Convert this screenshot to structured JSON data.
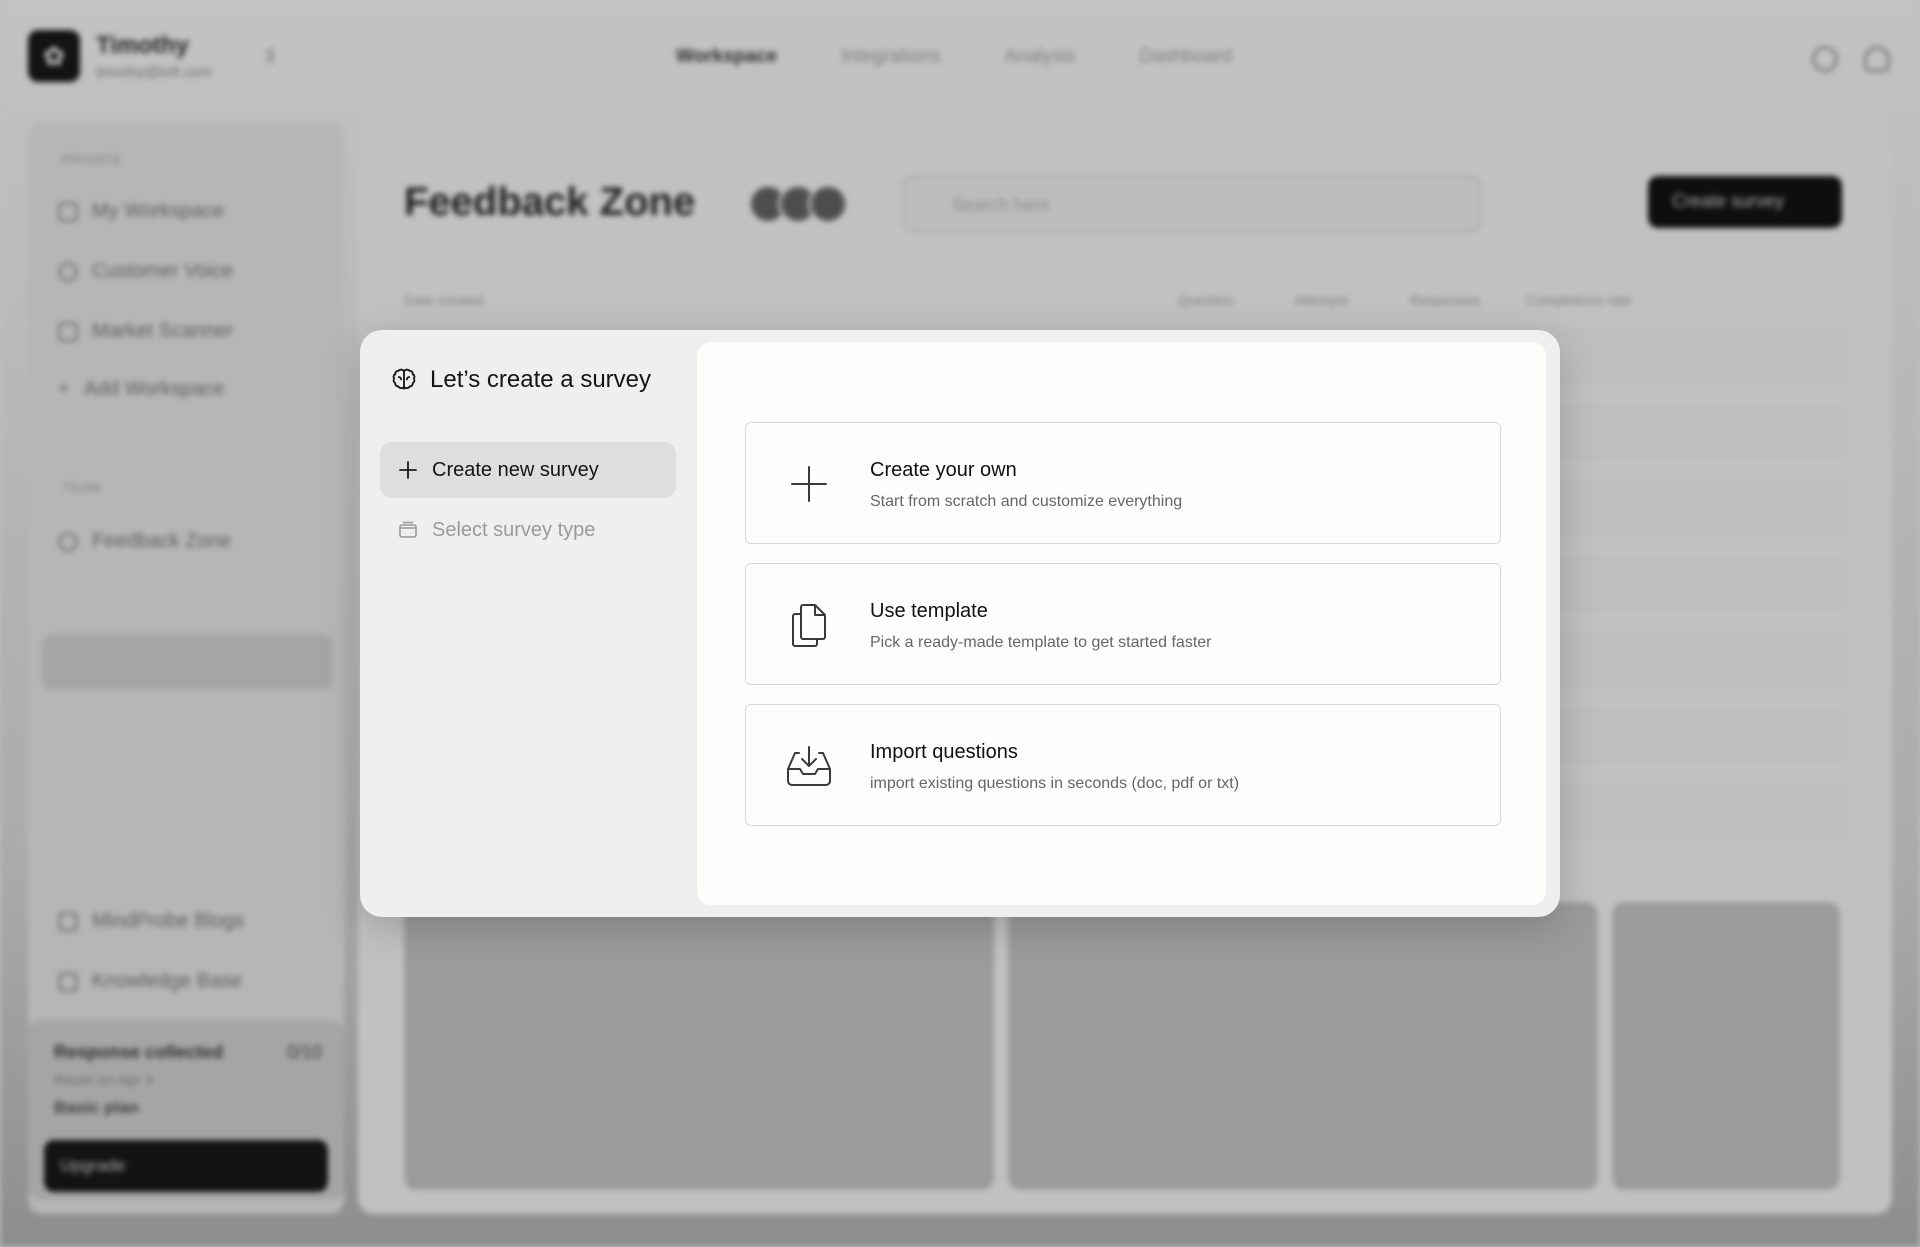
{
  "app": {
    "user": {
      "name": "Timothy",
      "email": "timothy@loft.com"
    },
    "nav": [
      "Workspace",
      "Integrations",
      "Analysis",
      "Dashboard"
    ],
    "sidebar": {
      "private_label": "PRIVATE",
      "private_items": [
        "My Workspace",
        "Customer Voice",
        "Market Scanner",
        "Add Workspace"
      ],
      "team_label": "TEAM",
      "team_items": [
        "Feedback Zone"
      ],
      "bottom_items": [
        "MindProbe Blogs",
        "Knowledge Base"
      ],
      "usage": {
        "title": "Response collected",
        "count": "0/10",
        "reset": "Reset on Apr 3",
        "plan": "Basic plan"
      },
      "upgrade_label": "Upgrade"
    },
    "main": {
      "title": "Feedback Zone",
      "search_placeholder": "Search here",
      "create_button": "Create survey",
      "date_filter": "Date created",
      "columns": [
        "Question",
        "Attempts",
        "Responses",
        "Completions rate"
      ]
    }
  },
  "modal": {
    "title": "Let’s create a survey",
    "steps": [
      {
        "label": "Create new survey",
        "icon": "plus-icon",
        "active": true
      },
      {
        "label": "Select survey type",
        "icon": "folder-icon",
        "active": false
      }
    ],
    "options": [
      {
        "title": "Create your own",
        "description": "Start from scratch and customize everything",
        "icon": "plus-icon"
      },
      {
        "title": "Use template",
        "description": "Pick a ready-made template to get started faster",
        "icon": "copy-document-icon"
      },
      {
        "title": "Import questions",
        "description": "import existing questions in seconds (doc, pdf or txt)",
        "icon": "inbox-download-icon"
      }
    ]
  }
}
